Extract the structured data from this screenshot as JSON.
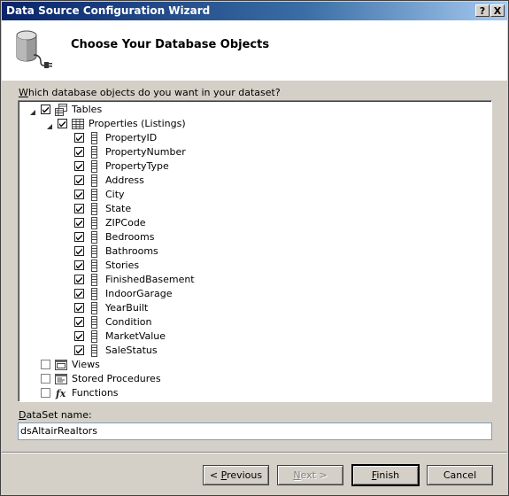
{
  "window": {
    "title": "Data Source Configuration Wizard",
    "help_btn": "?",
    "close_btn": "X"
  },
  "header": {
    "heading": "Choose Your Database Objects",
    "icon": "database-connection-icon"
  },
  "question": {
    "prefix": "W",
    "rest": "hich database objects do you want in your dataset?"
  },
  "tree": {
    "tables": {
      "label": "Tables",
      "checked": true,
      "expanded": true,
      "icon": "tables-icon"
    },
    "table": {
      "label": "Properties (Listings)",
      "checked": true,
      "expanded": true,
      "icon": "table-icon"
    },
    "columns": [
      {
        "label": "PropertyID",
        "checked": true
      },
      {
        "label": "PropertyNumber",
        "checked": true
      },
      {
        "label": "PropertyType",
        "checked": true
      },
      {
        "label": "Address",
        "checked": true
      },
      {
        "label": "City",
        "checked": true
      },
      {
        "label": "State",
        "checked": true
      },
      {
        "label": "ZIPCode",
        "checked": true
      },
      {
        "label": "Bedrooms",
        "checked": true
      },
      {
        "label": "Bathrooms",
        "checked": true
      },
      {
        "label": "Stories",
        "checked": true
      },
      {
        "label": "FinishedBasement",
        "checked": true
      },
      {
        "label": "IndoorGarage",
        "checked": true
      },
      {
        "label": "YearBuilt",
        "checked": true
      },
      {
        "label": "Condition",
        "checked": true
      },
      {
        "label": "MarketValue",
        "checked": true
      },
      {
        "label": "SaleStatus",
        "checked": true
      }
    ],
    "others": [
      {
        "label": "Views",
        "checked": false,
        "icon": "views-icon"
      },
      {
        "label": "Stored Procedures",
        "checked": false,
        "icon": "stored-procedures-icon"
      },
      {
        "label": "Functions",
        "checked": false,
        "icon": "functions-icon"
      }
    ]
  },
  "dataset": {
    "label_prefix": "D",
    "label_rest": "ataSet name:",
    "value": "dsAltairRealtors"
  },
  "buttons": {
    "previous": {
      "pre": "< ",
      "key": "P",
      "rest": "revious"
    },
    "next": {
      "key": "N",
      "rest": "ext >"
    },
    "finish": {
      "key": "F",
      "rest": "inish"
    },
    "cancel": "Cancel"
  }
}
